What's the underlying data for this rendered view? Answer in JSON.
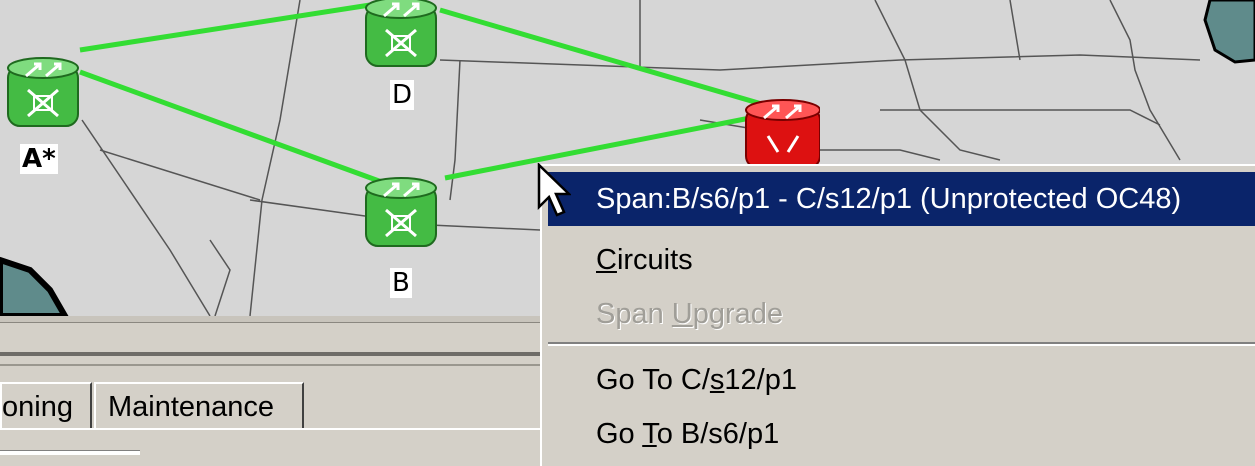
{
  "map": {
    "background": "#d6d6d6",
    "link_color": "#33dd33",
    "nodes": [
      {
        "id": "A",
        "label": "A*",
        "status": "normal"
      },
      {
        "id": "D",
        "label": "D",
        "status": "normal"
      },
      {
        "id": "B",
        "label": "B",
        "status": "normal"
      },
      {
        "id": "C",
        "label": "",
        "status": "alarm"
      }
    ]
  },
  "context_menu": {
    "header": "Span:B/s6/p1 - C/s12/p1 (Unprotected OC48)",
    "items": [
      {
        "label_pre": "",
        "mnemonic": "C",
        "label_post": "ircuits",
        "enabled": true
      },
      {
        "label_pre": "Span ",
        "mnemonic": "U",
        "label_post": "pgrade",
        "enabled": false
      },
      {
        "label_pre": "Go To C/",
        "mnemonic": "s",
        "label_post": "12/p1",
        "enabled": true
      },
      {
        "label_pre": "Go ",
        "mnemonic": "T",
        "label_post": "o B/s6/p1",
        "enabled": true
      }
    ]
  },
  "tabs": [
    {
      "label": "oning"
    },
    {
      "label": "Maintenance"
    }
  ],
  "colors": {
    "menu_highlight": "#0a246a",
    "node_normal": "#44bb44",
    "node_alarm": "#dd1111"
  }
}
